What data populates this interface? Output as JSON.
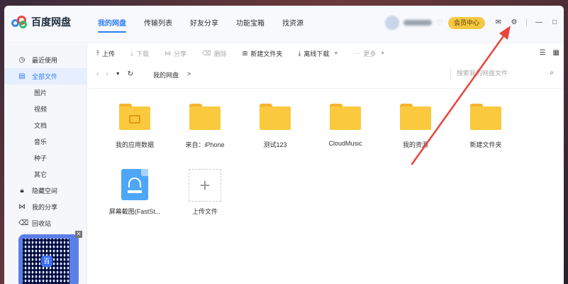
{
  "app": {
    "name": "百度网盘"
  },
  "nav": {
    "tabs": [
      "我的网盘",
      "传输列表",
      "好友分享",
      "功能宝箱",
      "找资源"
    ]
  },
  "header": {
    "vip_label": "会员中心"
  },
  "sidebar": {
    "items": [
      {
        "label": "最近使用",
        "icon": "clock-icon"
      },
      {
        "label": "全部文件",
        "icon": "file-icon"
      },
      {
        "label": "图片"
      },
      {
        "label": "视频"
      },
      {
        "label": "文档"
      },
      {
        "label": "音乐"
      },
      {
        "label": "种子"
      },
      {
        "label": "其它"
      },
      {
        "label": "隐藏空间",
        "icon": "lock-icon"
      },
      {
        "label": "我的分享",
        "icon": "share-icon"
      },
      {
        "label": "回收站",
        "icon": "trash-icon"
      }
    ]
  },
  "toolbar": {
    "upload": "上传",
    "download": "下载",
    "share": "分享",
    "delete": "删除",
    "new_folder": "新建文件夹",
    "offline_download": "离线下载",
    "more": "更多"
  },
  "address": {
    "crumb": "我的网盘",
    "crumb_sep": ">",
    "search_placeholder": "搜索我的网盘文件"
  },
  "files": [
    {
      "name": "我的应用数据",
      "type": "app-folder"
    },
    {
      "name": "来自：iPhone",
      "type": "folder"
    },
    {
      "name": "测试123",
      "type": "folder"
    },
    {
      "name": "CloudMusic",
      "type": "folder"
    },
    {
      "name": "我的资源",
      "type": "folder"
    },
    {
      "name": "新建文件夹",
      "type": "folder"
    },
    {
      "name": "屏幕截图(FastSt...",
      "type": "image"
    },
    {
      "name": "上传文件",
      "type": "upload"
    }
  ],
  "colors": {
    "accent": "#2f7ef5",
    "folder": "#fbc93d",
    "vip": "#f5c842",
    "annotation_arrow": "#e8453c"
  }
}
